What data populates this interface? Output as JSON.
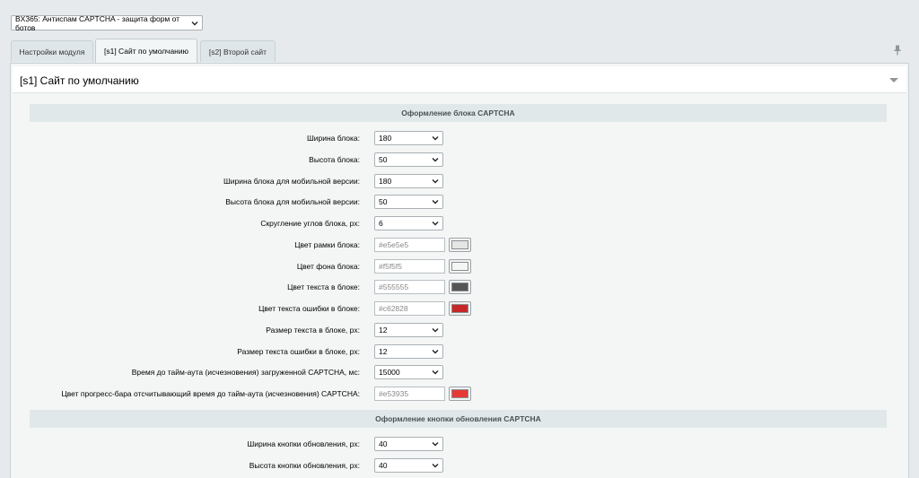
{
  "module_select": {
    "value": "BX365: Антиспам CAPTCHA - защита форм от ботов"
  },
  "tabs": [
    {
      "label": "Настройки модуля",
      "active": false
    },
    {
      "label": "[s1] Сайт по умолчанию",
      "active": true
    },
    {
      "label": "[s2] Второй сайт",
      "active": false
    }
  ],
  "panel": {
    "title": "[s1] Сайт по умолчанию"
  },
  "sections": [
    "Оформление блока CAPTCHA",
    "Оформление кнопки обновления CAPTCHA"
  ],
  "rows": [
    {
      "label": "Ширина блока:",
      "type": "select",
      "value": "180"
    },
    {
      "label": "Высота блока:",
      "type": "select",
      "value": "50"
    },
    {
      "label": "Ширина блока для мобильной версии:",
      "type": "select",
      "value": "180"
    },
    {
      "label": "Высота блока для мобильной версии:",
      "type": "select",
      "value": "50"
    },
    {
      "label": "Скругление углов блока, px:",
      "type": "select",
      "value": "6"
    },
    {
      "label": "Цвет рамки блока:",
      "type": "color",
      "value": "#e5e5e5",
      "color": "#e5e5e5"
    },
    {
      "label": "Цвет фона блока:",
      "type": "color",
      "value": "#f5f5f5",
      "color": "#f5f5f5"
    },
    {
      "label": "Цвет текста в блоке:",
      "type": "color",
      "value": "#555555",
      "color": "#555555"
    },
    {
      "label": "Цвет текста ошибки в блоке:",
      "type": "color",
      "value": "#c62828",
      "color": "#c62828"
    },
    {
      "label": "Размер текста в блоке, px:",
      "type": "select",
      "value": "12"
    },
    {
      "label": "Размер текста ошибки в блоке, px:",
      "type": "select",
      "value": "12"
    },
    {
      "label": "Время до тайм-аута (исчезновения) загруженной CAPTCHA, мс:",
      "type": "select",
      "value": "15000"
    },
    {
      "label": "Цвет прогресс-бара отсчитывающий время до тайм-аута (исчезновения) CAPTCHA:",
      "type": "color",
      "value": "#e53935",
      "color": "#e53935"
    }
  ],
  "rows2": [
    {
      "label": "Ширина кнопки обновления, px:",
      "type": "select",
      "value": "40"
    },
    {
      "label": "Высота кнопки обновления, px:",
      "type": "select",
      "value": "40"
    }
  ],
  "icons": {
    "select_arrow": "chevron-down-icon",
    "pin": "pin-icon",
    "collapse": "collapse-triangle-icon"
  }
}
